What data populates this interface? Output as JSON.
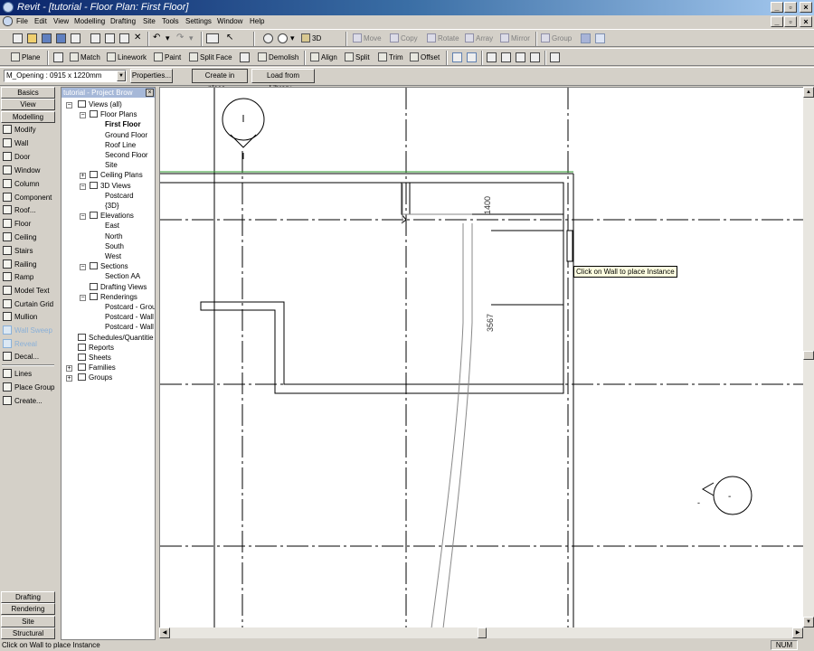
{
  "window": {
    "title": "Revit - [tutorial - Floor Plan: First Floor]",
    "controls": {
      "minimize": "_",
      "restore": "▫",
      "close": "×"
    }
  },
  "menu": [
    "File",
    "Edit",
    "View",
    "Modelling",
    "Drafting",
    "Site",
    "Tools",
    "Settings",
    "Window",
    "Help"
  ],
  "toolbar1": {
    "view3d": "3D",
    "move": "Move",
    "copy": "Copy",
    "rotate": "Rotate",
    "array": "Array",
    "mirror": "Mirror",
    "group": "Group"
  },
  "toolbar2": {
    "plane": "Plane",
    "match": "Match",
    "linework": "Linework",
    "paint": "Paint",
    "split_face": "Split Face",
    "demolish": "Demolish",
    "align": "Align",
    "split": "Split",
    "trim": "Trim",
    "offset": "Offset"
  },
  "options": {
    "type_selector": "M_Opening : 0915 x 1220mm",
    "properties": "Properties...",
    "create_in_place": "Create in place...",
    "load_from_library": "Load from Library..."
  },
  "designbar": {
    "tabs_top": [
      "Basics",
      "View",
      "Modelling"
    ],
    "tools": [
      {
        "label": "Modify",
        "icon": "arrow-icon",
        "disabled": false
      },
      {
        "label": "Wall",
        "icon": "wall-icon",
        "disabled": false
      },
      {
        "label": "Door",
        "icon": "door-icon",
        "disabled": false
      },
      {
        "label": "Window",
        "icon": "window-icon",
        "disabled": false
      },
      {
        "label": "Column",
        "icon": "column-icon",
        "disabled": false
      },
      {
        "label": "Component",
        "icon": "component-icon",
        "disabled": false
      },
      {
        "label": "Roof...",
        "icon": "roof-icon",
        "disabled": false
      },
      {
        "label": "Floor",
        "icon": "floor-icon",
        "disabled": false
      },
      {
        "label": "Ceiling",
        "icon": "ceiling-icon",
        "disabled": false
      },
      {
        "label": "Stairs",
        "icon": "stairs-icon",
        "disabled": false
      },
      {
        "label": "Railing",
        "icon": "railing-icon",
        "disabled": false
      },
      {
        "label": "Ramp",
        "icon": "ramp-icon",
        "disabled": false
      },
      {
        "label": "Model Text",
        "icon": "text-icon",
        "disabled": false
      },
      {
        "label": "Curtain Grid",
        "icon": "curtain-grid-icon",
        "disabled": false
      },
      {
        "label": "Mullion",
        "icon": "mullion-icon",
        "disabled": false
      },
      {
        "label": "Wall Sweep",
        "icon": "wall-sweep-icon",
        "disabled": true
      },
      {
        "label": "Reveal",
        "icon": "reveal-icon",
        "disabled": true
      },
      {
        "label": "Decal...",
        "icon": "decal-icon",
        "disabled": false
      },
      {
        "label": "Lines",
        "icon": "lines-icon",
        "disabled": false
      },
      {
        "label": "Place Group",
        "icon": "place-group-icon",
        "disabled": false
      },
      {
        "label": "Create...",
        "icon": "create-icon",
        "disabled": false
      }
    ],
    "tabs_bottom": [
      "Drafting",
      "Rendering",
      "Site",
      "Structural"
    ]
  },
  "browser": {
    "title": "tutorial - Project Brow",
    "close": "×",
    "nodes": [
      {
        "label": "Views (all)",
        "level": 0,
        "toggle": "−",
        "icon": "views-icon"
      },
      {
        "label": "Floor Plans",
        "level": 1,
        "toggle": "−",
        "icon": "floor-plans-icon"
      },
      {
        "label": "First Floor",
        "level": 2,
        "bold": true
      },
      {
        "label": "Ground Floor",
        "level": 2
      },
      {
        "label": "Roof Line",
        "level": 2
      },
      {
        "label": "Second Floor",
        "level": 2
      },
      {
        "label": "Site",
        "level": 2
      },
      {
        "label": "Ceiling Plans",
        "level": 1,
        "toggle": "+",
        "icon": "ceiling-plans-icon"
      },
      {
        "label": "3D Views",
        "level": 1,
        "toggle": "−",
        "icon": "3d-views-icon"
      },
      {
        "label": "Postcard",
        "level": 2
      },
      {
        "label": "{3D}",
        "level": 2
      },
      {
        "label": "Elevations",
        "level": 1,
        "toggle": "−",
        "icon": "elevations-icon"
      },
      {
        "label": "East",
        "level": 2
      },
      {
        "label": "North",
        "level": 2
      },
      {
        "label": "South",
        "level": 2
      },
      {
        "label": "West",
        "level": 2
      },
      {
        "label": "Sections",
        "level": 1,
        "toggle": "−",
        "icon": "sections-icon"
      },
      {
        "label": "Section AA",
        "level": 2
      },
      {
        "label": "Drafting Views",
        "level": 1,
        "icon": "drafting-views-icon"
      },
      {
        "label": "Renderings",
        "level": 1,
        "toggle": "−",
        "icon": "renderings-icon"
      },
      {
        "label": "Postcard - Grou",
        "level": 2
      },
      {
        "label": "Postcard - Wall",
        "level": 2
      },
      {
        "label": "Postcard - Wall",
        "level": 2
      },
      {
        "label": "Schedules/Quantitie",
        "level": 0,
        "icon": "schedules-icon"
      },
      {
        "label": "Reports",
        "level": 0,
        "icon": "reports-icon"
      },
      {
        "label": "Sheets",
        "level": 0,
        "icon": "sheets-icon"
      },
      {
        "label": "Families",
        "level": 0,
        "toggle": "+",
        "icon": "families-icon"
      },
      {
        "label": "Groups",
        "level": 0,
        "toggle": "+",
        "icon": "groups-icon"
      }
    ]
  },
  "drawing": {
    "dimension_1": "1400",
    "dimension_2": "3567",
    "tooltip": "Click on Wall to place Instance",
    "elevation_mark_label": "-"
  },
  "status": {
    "message": "Click on Wall to place Instance",
    "num": "NUM"
  }
}
